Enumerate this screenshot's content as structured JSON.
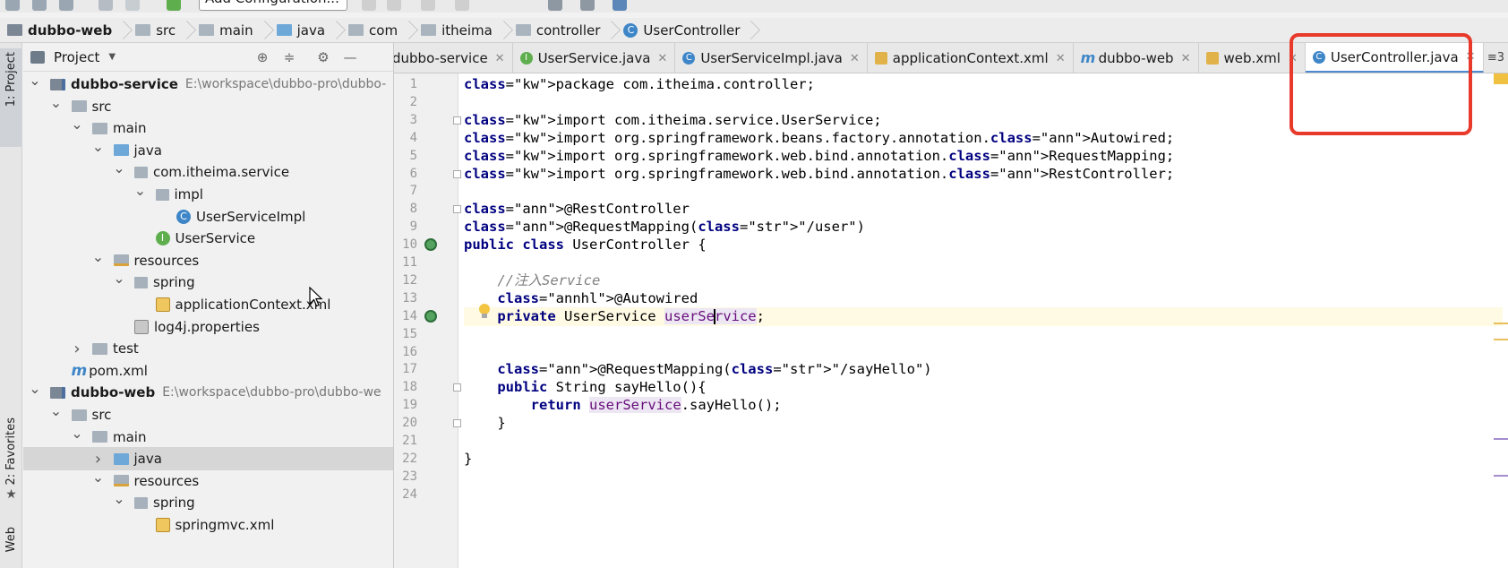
{
  "toolbar": {
    "run_config": "Add Configuration..."
  },
  "breadcrumb": [
    "dubbo-web",
    "src",
    "main",
    "java",
    "com",
    "itheima",
    "controller",
    "UserController"
  ],
  "left_stripe": {
    "project_tab": "1: Project",
    "favorites_tab": "2: Favorites",
    "web_tab": "Web"
  },
  "project_panel": {
    "title": "Project",
    "tree": [
      {
        "label": "dubbo-service",
        "path": "E:\\workspace\\dubbo-pro\\dubbo-",
        "icon": "module",
        "expanded": true,
        "bold": true
      },
      {
        "label": "src",
        "icon": "folder",
        "expanded": true
      },
      {
        "label": "main",
        "icon": "folder",
        "expanded": true
      },
      {
        "label": "java",
        "icon": "source-folder",
        "expanded": true
      },
      {
        "label": "com.itheima.service",
        "icon": "package",
        "expanded": true
      },
      {
        "label": "impl",
        "icon": "package",
        "expanded": true
      },
      {
        "label": "UserServiceImpl",
        "icon": "class"
      },
      {
        "label": "UserService",
        "icon": "interface"
      },
      {
        "label": "resources",
        "icon": "resources-folder",
        "expanded": true
      },
      {
        "label": "spring",
        "icon": "package",
        "expanded": true
      },
      {
        "label": "applicationContext.xml",
        "icon": "xml-file"
      },
      {
        "label": "log4j.properties",
        "icon": "properties-file"
      },
      {
        "label": "test",
        "icon": "folder",
        "expanded": false
      },
      {
        "label": "pom.xml",
        "icon": "maven"
      },
      {
        "label": "dubbo-web",
        "path": "E:\\workspace\\dubbo-pro\\dubbo-we",
        "icon": "module",
        "expanded": true,
        "bold": true
      },
      {
        "label": "src",
        "icon": "folder",
        "expanded": true
      },
      {
        "label": "main",
        "icon": "folder",
        "expanded": true
      },
      {
        "label": "java",
        "icon": "source-folder",
        "expanded": false,
        "selected": true
      },
      {
        "label": "resources",
        "icon": "resources-folder",
        "expanded": true
      },
      {
        "label": "spring",
        "icon": "package",
        "expanded": true
      },
      {
        "label": "springmvc.xml",
        "icon": "xml-file"
      }
    ]
  },
  "tabs": [
    {
      "label": "dubbo-service",
      "icon": "none",
      "active": false
    },
    {
      "label": "UserService.java",
      "icon": "interface",
      "active": false
    },
    {
      "label": "UserServiceImpl.java",
      "icon": "class",
      "active": false
    },
    {
      "label": "applicationContext.xml",
      "icon": "xml",
      "active": false
    },
    {
      "label": "dubbo-web",
      "icon": "maven",
      "active": false
    },
    {
      "label": "web.xml",
      "icon": "xml",
      "active": false
    },
    {
      "label": "UserController.java",
      "icon": "class",
      "active": true
    }
  ],
  "tab_overflow": "≡3",
  "editor": {
    "current_line": 14,
    "lines": [
      "package com.itheima.controller;",
      "",
      "import com.itheima.service.UserService;",
      "import org.springframework.beans.factory.annotation.Autowired;",
      "import org.springframework.web.bind.annotation.RequestMapping;",
      "import org.springframework.web.bind.annotation.RestController;",
      "",
      "@RestController",
      "@RequestMapping(\"/user\")",
      "public class UserController {",
      "",
      "    //注入Service",
      "    @Autowired",
      "    private UserService userService;",
      "",
      "",
      "    @RequestMapping(\"/sayHello\")",
      "    public String sayHello(){",
      "        return userService.sayHello();",
      "    }",
      "",
      "}",
      "",
      ""
    ]
  },
  "colors": {
    "highlight": "#e8392a",
    "active_tab": "#4d88d0",
    "current_line": "#fffae3"
  }
}
